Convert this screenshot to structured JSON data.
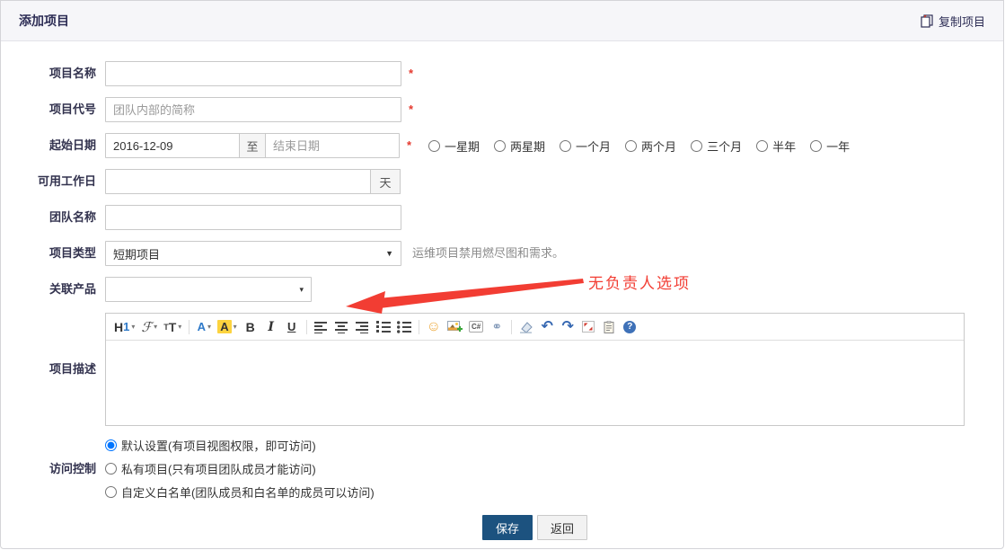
{
  "header": {
    "title": "添加项目",
    "copy_label": "复制项目"
  },
  "icons": {
    "select_caret": "▼",
    "product_caret": "▾",
    "toolbar_caret": "▾"
  },
  "form": {
    "required_mark": "*",
    "fields": {
      "project_name": {
        "label": "项目名称"
      },
      "project_code": {
        "label": "项目代号",
        "placeholder": "团队内部的简称"
      },
      "date_range": {
        "label": "起始日期",
        "start_value": "2016-12-09",
        "to_label": "至",
        "end_placeholder": "结束日期",
        "duration_options": [
          "一星期",
          "两星期",
          "一个月",
          "两个月",
          "三个月",
          "半年",
          "一年"
        ]
      },
      "workdays": {
        "label": "可用工作日",
        "unit": "天"
      },
      "team_name": {
        "label": "团队名称"
      },
      "project_type": {
        "label": "项目类型",
        "value": "短期项目",
        "note": "运维项目禁用燃尽图和需求。"
      },
      "linked_product": {
        "label": "关联产品"
      },
      "description": {
        "label": "项目描述"
      },
      "access": {
        "label": "访问控制",
        "options": [
          "默认设置(有项目视图权限，即可访问)",
          "私有项目(只有项目团队成员才能访问)",
          "自定义白名单(团队成员和白名单的成员可以访问)"
        ],
        "selected_index": 0
      }
    },
    "annotation": {
      "text": "无负责人选项"
    },
    "buttons": {
      "save": "保存",
      "back": "返回"
    }
  },
  "editor": {
    "glyphs": {
      "heading_h": "H",
      "heading_1": "1",
      "font_family": "ℱ",
      "size_small": "T",
      "size_large": "T",
      "color_a": "A",
      "highlight_a": "A",
      "bold": "B",
      "italic": "I",
      "underline": "U",
      "smiley": "☺",
      "code": "C#",
      "link": "⚭",
      "undo": "↶",
      "redo": "↷",
      "help": "?"
    }
  },
  "colors": {
    "save_button": "#1c527f",
    "annotation_red": "#f23d33",
    "required_red": "#e5392e",
    "header_bg": "#f6f6f9",
    "title_navy": "#2d2d55"
  }
}
